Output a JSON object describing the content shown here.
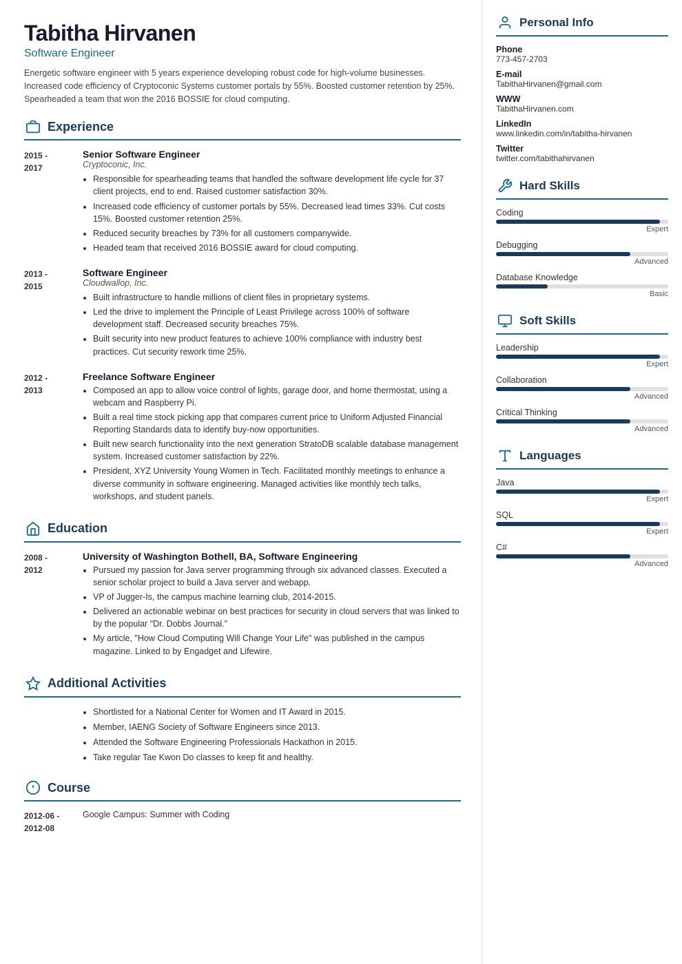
{
  "header": {
    "name": "Tabitha Hirvanen",
    "title": "Software Engineer",
    "summary": "Energetic software engineer with 5 years experience developing robust code for high-volume businesses. Increased code efficiency of Cryptoconic Systems customer portals by 55%. Boosted customer retention by 25%. Spearheaded a team that won the 2016 BOSSIE for cloud computing."
  },
  "sections": {
    "experience_label": "Experience",
    "education_label": "Education",
    "activities_label": "Additional Activities",
    "course_label": "Course"
  },
  "experience": [
    {
      "dates": "2015 -\n2017",
      "title": "Senior Software Engineer",
      "company": "Cryptoconic, Inc.",
      "bullets": [
        "Responsible for spearheading teams that handled the software development life cycle for 37 client projects, end to end. Raised customer satisfaction 30%.",
        "Increased code efficiency of customer portals by 55%. Decreased lead times 33%. Cut costs 15%. Boosted customer retention 25%.",
        "Reduced security breaches by 73% for all customers companywide.",
        "Headed team that received 2016 BOSSIE award for cloud computing."
      ]
    },
    {
      "dates": "2013 -\n2015",
      "title": "Software Engineer",
      "company": "Cloudwallop, Inc.",
      "bullets": [
        "Built infrastructure to handle millions of client files in proprietary systems.",
        "Led the drive to implement the Principle of Least Privilege across 100% of software development staff. Decreased security breaches 75%.",
        "Built security into new product features to achieve 100% compliance with industry best practices. Cut security rework time 25%."
      ]
    },
    {
      "dates": "2012 -\n2013",
      "title": "Freelance Software Engineer",
      "company": "",
      "bullets": [
        "Composed an app to allow voice control of lights, garage door, and home thermostat, using a webcam and Raspberry Pi.",
        "Built a real time stock picking app that compares current price to Uniform Adjusted Financial Reporting Standards data to identify buy-now opportunities.",
        "Built new search functionality into the next generation StratoDB scalable database management system. Increased customer satisfaction by 22%.",
        "President, XYZ University Young Women in Tech. Facilitated monthly meetings to enhance a diverse community in software engineering. Managed activities like monthly tech talks, workshops, and student panels."
      ]
    }
  ],
  "education": [
    {
      "dates": "2008 -\n2012",
      "title": "University of Washington Bothell, BA, Software Engineering",
      "company": "",
      "bullets": [
        "Pursued my passion for Java server programming through six advanced classes. Executed a senior scholar project to build a Java server and webapp.",
        "VP of Jugger-Is, the campus machine learning club, 2014-2015.",
        "Delivered an actionable webinar on best practices for security in cloud servers that was linked to by the popular \"Dr. Dobbs Journal.\"",
        "My article, \"How Cloud Computing Will Change Your Life\" was published in the campus magazine. Linked to by Engadget and Lifewire."
      ]
    }
  ],
  "activities": [
    "Shortlisted for a National Center for Women and IT Award in 2015.",
    "Member, IAENG Society of Software Engineers since 2013.",
    "Attended the Software Engineering Professionals Hackathon in 2015.",
    "Take regular Tae Kwon Do classes to keep fit and healthy."
  ],
  "courses": [
    {
      "dates": "2012-06 -\n2012-08",
      "name": "Google Campus: Summer with Coding"
    }
  ],
  "personal_info": {
    "label": "Personal Info",
    "fields": [
      {
        "label": "Phone",
        "value": "773-457-2703"
      },
      {
        "label": "E-mail",
        "value": "TabithaHirvanen@gmail.com"
      },
      {
        "label": "WWW",
        "value": "TabithaHirvanen.com"
      },
      {
        "label": "LinkedIn",
        "value": "www.linkedin.com/in/tabitha-hirvanen"
      },
      {
        "label": "Twitter",
        "value": "twitter.com/tabithahirvanen"
      }
    ]
  },
  "hard_skills": {
    "label": "Hard Skills",
    "items": [
      {
        "name": "Coding",
        "level": "Expert",
        "pct": 95
      },
      {
        "name": "Debugging",
        "level": "Advanced",
        "pct": 78
      },
      {
        "name": "Database Knowledge",
        "level": "Basic",
        "pct": 30
      }
    ]
  },
  "soft_skills": {
    "label": "Soft Skills",
    "items": [
      {
        "name": "Leadership",
        "level": "Expert",
        "pct": 95
      },
      {
        "name": "Collaboration",
        "level": "Advanced",
        "pct": 78
      },
      {
        "name": "Critical Thinking",
        "level": "Advanced",
        "pct": 78
      }
    ]
  },
  "languages": {
    "label": "Languages",
    "items": [
      {
        "name": "Java",
        "level": "Expert",
        "pct": 95
      },
      {
        "name": "SQL",
        "level": "Expert",
        "pct": 95
      },
      {
        "name": "C#",
        "level": "Advanced",
        "pct": 78
      }
    ]
  }
}
